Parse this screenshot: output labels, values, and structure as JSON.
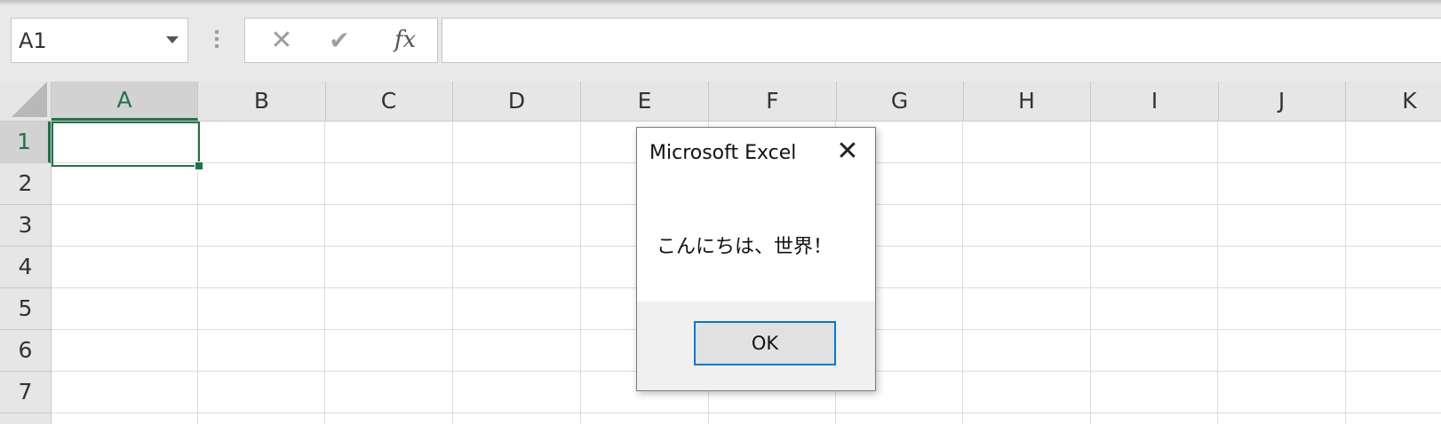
{
  "name_box": {
    "value": "A1"
  },
  "formula_bar": {
    "cancel_icon": "cross-icon",
    "enter_icon": "check-icon",
    "function_label": "fx",
    "value": ""
  },
  "columns": [
    "A",
    "B",
    "C",
    "D",
    "E",
    "F",
    "G",
    "H",
    "I",
    "J",
    "K"
  ],
  "rows": [
    "1",
    "2",
    "3",
    "4",
    "5",
    "6",
    "7"
  ],
  "active_cell": "A1",
  "colors": {
    "accent": "#217346",
    "dialog_focus": "#0078d7"
  },
  "dialog": {
    "title": "Microsoft Excel",
    "close_glyph": "✕",
    "message": "こんにちは、世界！",
    "ok_label": "OK"
  }
}
